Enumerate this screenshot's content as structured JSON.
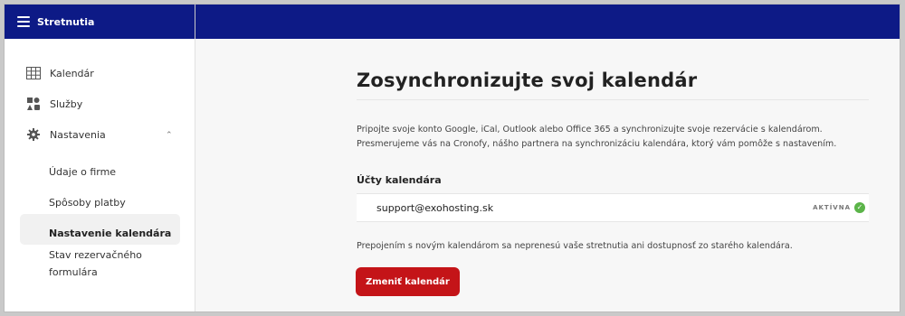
{
  "app": {
    "title": "Stretnutia",
    "menu_icon": "hamburger-icon"
  },
  "sidebar": {
    "items": [
      {
        "label": "Kalendár",
        "icon": "calendar-grid-icon"
      },
      {
        "label": "Služby",
        "icon": "services-icon"
      },
      {
        "label": "Nastavenia",
        "icon": "gear-icon",
        "expanded": true
      }
    ],
    "subitems": [
      {
        "label": "Údaje o firme"
      },
      {
        "label": "Spôsoby platby"
      },
      {
        "label": "Nastavenie kalendára",
        "active": true
      },
      {
        "label_line1": "Stav rezervačného",
        "label_line2": "formulára"
      }
    ]
  },
  "main": {
    "title": "Zosynchronizujte svoj kalendár",
    "description_line1": "Pripojte svoje konto Google, iCal, Outlook alebo Office 365 a synchronizujte svoje rezervácie s kalendárom.",
    "description_line2": "Presmerujeme vás na Cronofy, nášho partnera na synchronizáciu kalendára, ktorý vám pomôže s nastavením.",
    "accounts_label": "Účty kalendára",
    "account": {
      "email": "support@exohosting.sk",
      "status": "AKTÍVNA",
      "status_color": "#5bb449"
    },
    "note": "Prepojením s novým kalendárom sa neprenesú vaše stretnutia ani dostupnosť zo starého kalendára.",
    "change_button": "Zmeniť kalendár",
    "accent_color": "#c41418",
    "topbar_color": "#0d1a86"
  }
}
